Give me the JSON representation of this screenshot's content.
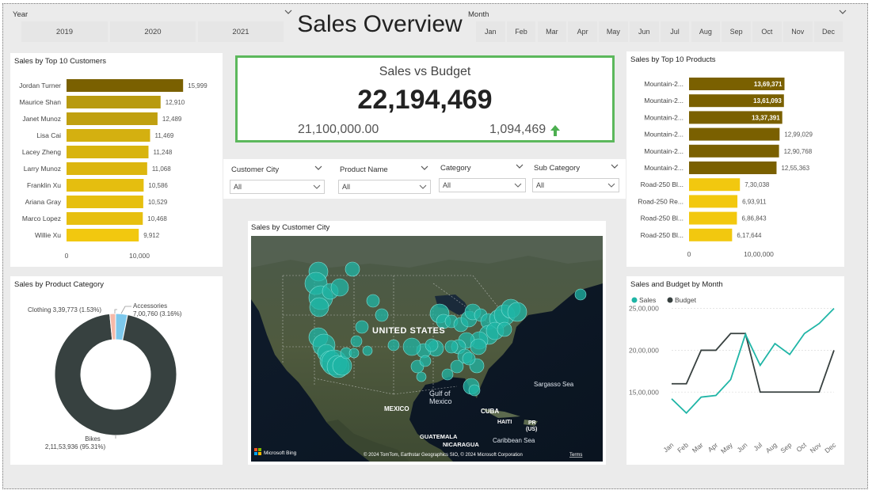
{
  "header": {
    "title": "Sales Overview",
    "year_label": "Year",
    "years": [
      "2019",
      "2020",
      "2021"
    ],
    "month_label": "Month",
    "months": [
      "Jan",
      "Feb",
      "Mar",
      "Apr",
      "May",
      "Jun",
      "Jul",
      "Aug",
      "Sep",
      "Oct",
      "Nov",
      "Dec"
    ]
  },
  "kpi": {
    "title": "Sales vs Budget",
    "value": "22,194,469",
    "budget": "21,100,000.00",
    "difference": "1,094,469",
    "trend_icon": "arrow-up-icon",
    "border_color": "#5cb85c"
  },
  "filters": [
    {
      "label": "Customer City",
      "value": "All"
    },
    {
      "label": "Product Name",
      "value": "All"
    },
    {
      "label": "Category",
      "value": "All"
    },
    {
      "label": "Sub Category",
      "value": "All"
    }
  ],
  "map": {
    "title": "Sales by Customer City",
    "labels": {
      "us": "UNITED STATES",
      "gulf1": "Gulf of",
      "gulf2": "Mexico",
      "mexico": "MEXICO",
      "cuba": "CUBA",
      "haiti": "HAITI",
      "pr1": "PR",
      "pr2": "(US)",
      "guatemala": "GUATEMALA",
      "nicaragua": "NICARAGUA",
      "caribbean": "Caribbean Sea",
      "sargasso": "Sargasso Sea"
    },
    "bing": "Microsoft Bing",
    "copyright": "© 2024 TomTom, Earthstar Geographics SIO, © 2024 Microsoft Corporation",
    "terms": "Terms"
  },
  "colors": {
    "accent_teal": "#1fb5a6",
    "budget_dark": "#37403f",
    "bar_dark": "#7a6000",
    "bar_gold": "#f2c80f",
    "donut_dark": "#374140",
    "donut_blue": "#7dc8ec",
    "donut_pink": "#f6b9a8"
  },
  "chart_data": [
    {
      "id": "customers",
      "type": "bar",
      "orientation": "horizontal",
      "title": "Sales by Top 10 Customers",
      "categories": [
        "Jordan Turner",
        "Maurice Shan",
        "Janet Munoz",
        "Lisa Cai",
        "Lacey Zheng",
        "Larry Munoz",
        "Franklin Xu",
        "Ariana Gray",
        "Marco Lopez",
        "Willie Xu"
      ],
      "values": [
        15999,
        12910,
        12489,
        11469,
        11248,
        11068,
        10586,
        10529,
        10468,
        9912
      ],
      "labels": [
        "15,999",
        "12,910",
        "12,489",
        "11,469",
        "11,248",
        "11,068",
        "10,586",
        "10,529",
        "10,468",
        "9,912"
      ],
      "xticks": [
        0,
        10000
      ],
      "xtick_labels": [
        "0",
        "10,000"
      ],
      "xlim": [
        0,
        20000
      ]
    },
    {
      "id": "products",
      "type": "bar",
      "orientation": "horizontal",
      "title": "Sales by Top 10 Products",
      "categories": [
        "Mountain-2...",
        "Mountain-2...",
        "Mountain-2...",
        "Mountain-2...",
        "Mountain-2...",
        "Mountain-2...",
        "Road-250 Bl...",
        "Road-250 Re...",
        "Road-250 Bl...",
        "Road-250 Bl..."
      ],
      "values": [
        1369371,
        1361093,
        1337391,
        1299029,
        1290768,
        1255363,
        730038,
        693911,
        686843,
        617644
      ],
      "labels": [
        "13,69,371",
        "13,61,093",
        "13,37,391",
        "12,99,029",
        "12,90,768",
        "12,55,363",
        "7,30,038",
        "6,93,911",
        "6,86,843",
        "6,17,644"
      ],
      "xticks": [
        0,
        1000000
      ],
      "xtick_labels": [
        "0",
        "10,00,000"
      ],
      "xlim": [
        0,
        2000000
      ]
    },
    {
      "id": "category",
      "type": "pie",
      "donut": true,
      "title": "Sales by Product Category",
      "categories": [
        "Bikes",
        "Clothing",
        "Accessories"
      ],
      "values": [
        21153936,
        339773,
        700760
      ],
      "labels": [
        {
          "name": "Bikes",
          "value": "2,11,53,936 (95.31%)"
        },
        {
          "name": "Clothing",
          "value": "3,39,773 (1.53%)"
        },
        {
          "name": "Accessories",
          "value": "7,00,760 (3.16%)"
        }
      ]
    },
    {
      "id": "monthly",
      "type": "line",
      "title": "Sales and Budget by Month",
      "categories": [
        "Jan",
        "Feb",
        "Mar",
        "Apr",
        "May",
        "Jun",
        "Jul",
        "Aug",
        "Sep",
        "Oct",
        "Nov",
        "Dec"
      ],
      "series": [
        {
          "name": "Sales",
          "values": [
            1420000,
            1250000,
            1440000,
            1460000,
            1650000,
            2190000,
            1820000,
            2080000,
            1950000,
            2200000,
            2320000,
            2500000
          ]
        },
        {
          "name": "Budget",
          "values": [
            1600000,
            1600000,
            2000000,
            2000000,
            2200000,
            2200000,
            1500000,
            1500000,
            1500000,
            1500000,
            1500000,
            2000000
          ]
        }
      ],
      "yticks": [
        1500000,
        2000000,
        2500000
      ],
      "ytick_labels": [
        "15,00,000",
        "20,00,000",
        "25,00,000"
      ],
      "ylim": [
        1200000,
        2600000
      ],
      "legend": "top-left"
    },
    {
      "id": "city",
      "type": "scatter",
      "title": "Sales by Customer City",
      "note": "bubble map of customer cities"
    }
  ]
}
